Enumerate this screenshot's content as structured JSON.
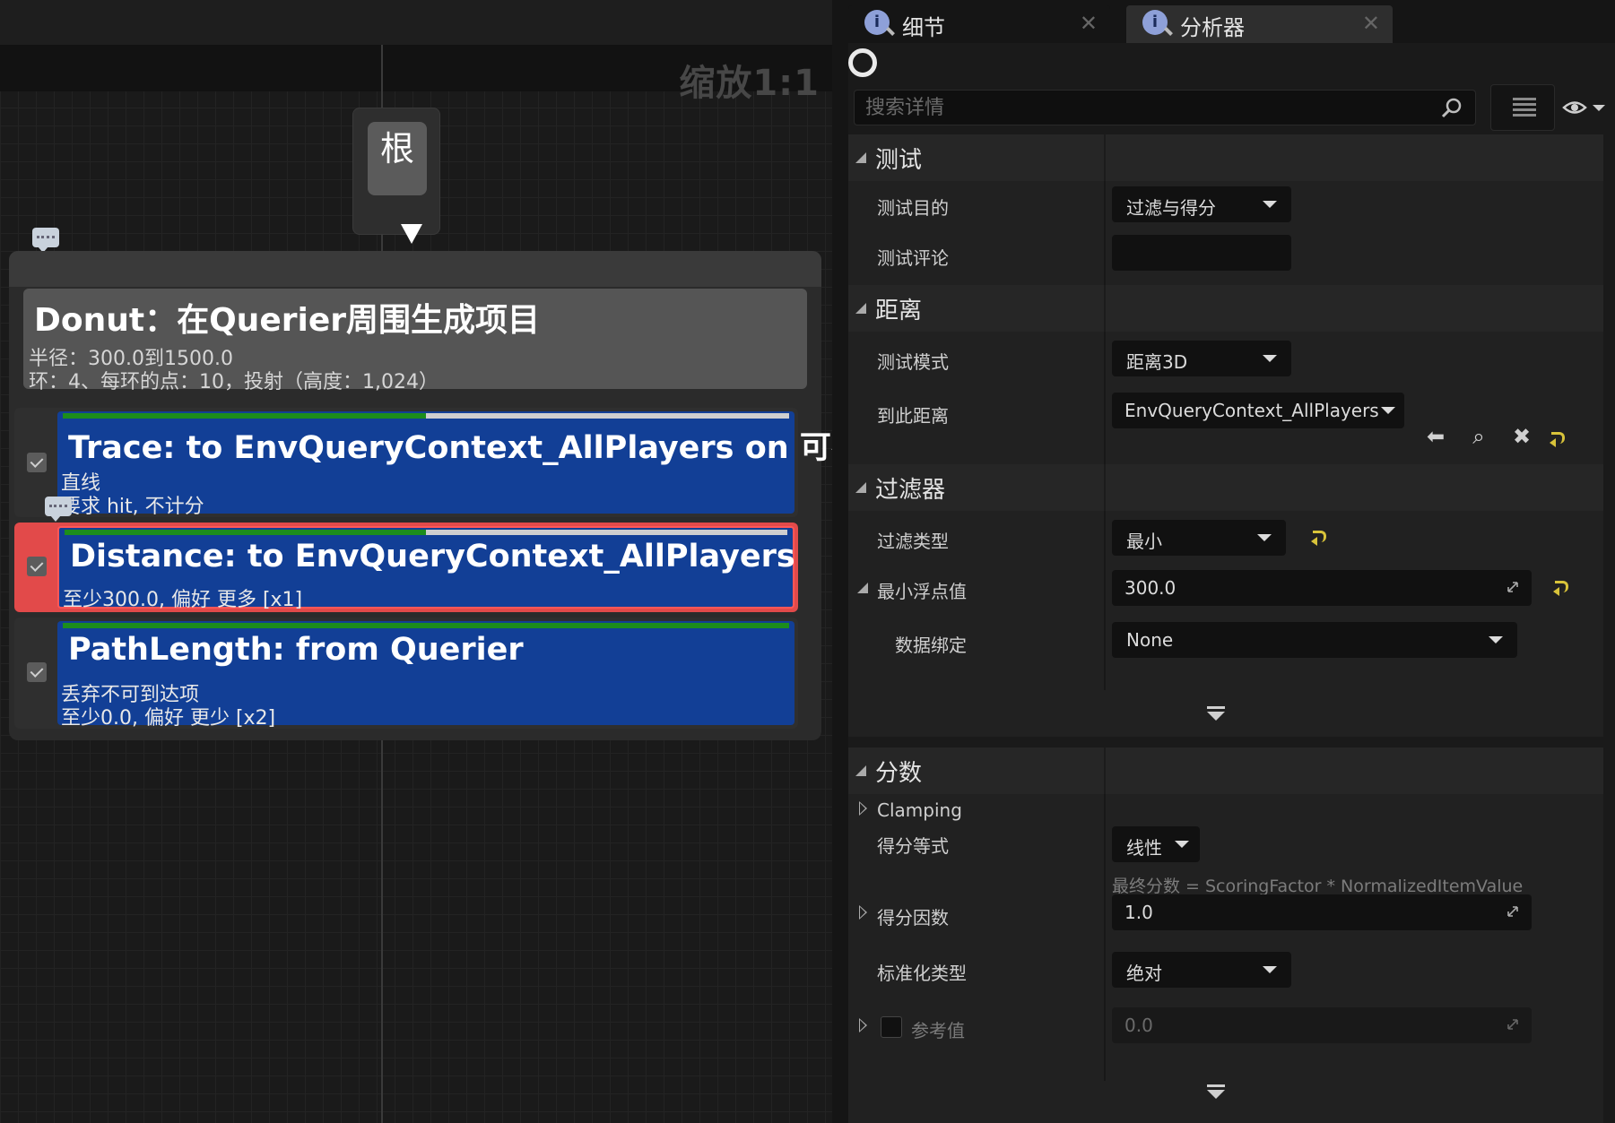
{
  "graph": {
    "zoom_label": "缩放1:1",
    "root_label": "根",
    "generator": {
      "title": "Donut：在Querier周围生成项目",
      "line1": "半径：300.0到1500.0",
      "line2": "环：4、每环的点：10，投射（高度：1,024）"
    },
    "tests": [
      {
        "title": "Trace: to EnvQueryContext_AllPlayers on 可视性",
        "lines": [
          "直线",
          "要求 hit, 不计分"
        ],
        "progress": 0.5
      },
      {
        "title": "Distance: to EnvQueryContext_AllPlayers",
        "lines": [
          "至少300.0, 偏好 更多 [x1]"
        ],
        "progress": 0.5
      },
      {
        "title": "PathLength: from Querier",
        "lines": [
          "丢弃不可到达项",
          "至少0.0, 偏好 更少 [x2]"
        ],
        "progress": 1.0
      }
    ]
  },
  "tabs": [
    {
      "label": "细节",
      "icon": "info-magnifier-icon",
      "active": false
    },
    {
      "label": "分析器",
      "icon": "info-magnifier-icon",
      "active": true
    }
  ],
  "search": {
    "placeholder": "搜索详情",
    "value": ""
  },
  "sections": {
    "test": {
      "title": "测试",
      "purpose_label": "测试目的",
      "purpose_value": "过滤与得分",
      "comment_label": "测试评论",
      "comment_value": ""
    },
    "distance": {
      "title": "距离",
      "mode_label": "测试模式",
      "mode_value": "距离3D",
      "to_label": "到此距离",
      "to_value": "EnvQueryContext_AllPlayers"
    },
    "filter": {
      "title": "过滤器",
      "type_label": "过滤类型",
      "type_value": "最小",
      "min_label": "最小浮点值",
      "min_value": "300.0",
      "binding_label": "数据绑定",
      "binding_value": "None"
    },
    "score": {
      "title": "分数",
      "clamping_label": "Clamping",
      "equation_label": "得分等式",
      "equation_value": "线性",
      "equation_hint": "最终分数 = ScoringFactor * NormalizedItemValue",
      "factor_label": "得分因数",
      "factor_value": "1.0",
      "normalize_label": "标准化类型",
      "normalize_value": "绝对",
      "reference_label": "参考值",
      "reference_value": "0.0"
    }
  },
  "colors": {
    "test_body": "#123f96",
    "selected_outline": "#e24a4a",
    "reset_icon": "#d8c33a",
    "progress_green": "#1c8d1c"
  }
}
